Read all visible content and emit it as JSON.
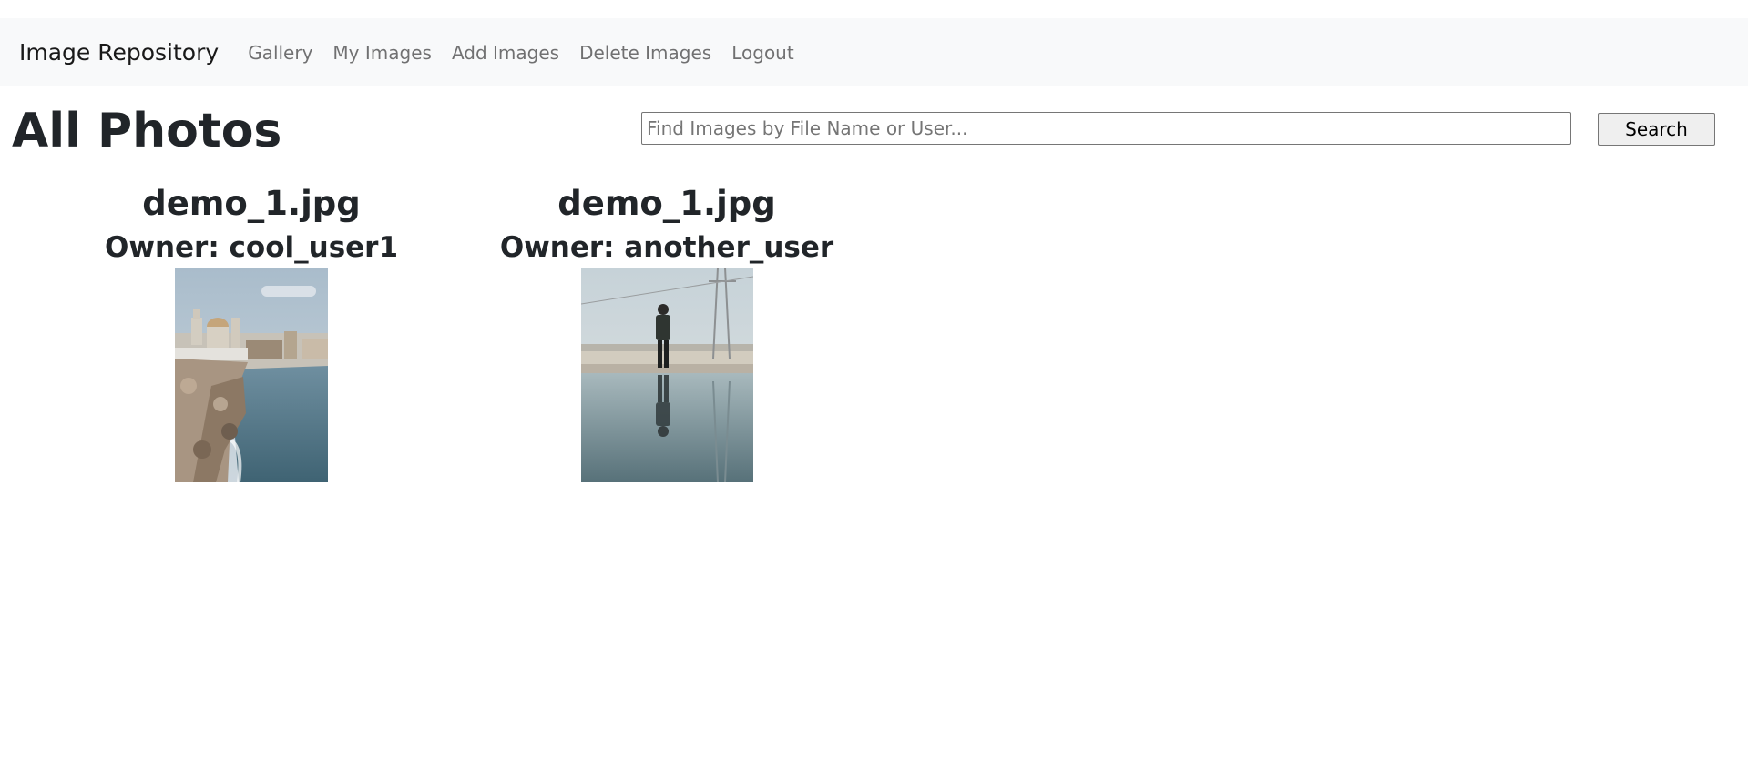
{
  "navbar": {
    "brand": "Image Repository",
    "links": [
      {
        "label": "Gallery"
      },
      {
        "label": "My Images"
      },
      {
        "label": "Add Images"
      },
      {
        "label": "Delete Images"
      },
      {
        "label": "Logout"
      }
    ]
  },
  "main": {
    "title": "All Photos",
    "search": {
      "placeholder": "Find Images by File Name or User...",
      "value": "",
      "button_label": "Search"
    },
    "photos": [
      {
        "file_name": "demo_1.jpg",
        "owner": "Owner: cool_user1"
      },
      {
        "file_name": "demo_1.jpg",
        "owner": "Owner: another_user"
      }
    ]
  },
  "colors": {
    "navbar_bg": "#f8f9fa",
    "text": "#212529",
    "nav_link": "#737373"
  }
}
